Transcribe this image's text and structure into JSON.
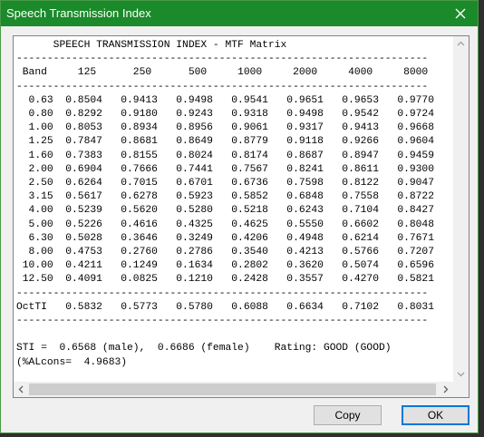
{
  "window": {
    "title": "Speech Transmission Index"
  },
  "content": {
    "lines": [
      "      SPEECH TRANSMISSION INDEX - MTF Matrix",
      "-------------------------------------------------------------------",
      " Band     125      250      500     1000     2000     4000     8000",
      "-------------------------------------------------------------------",
      "  0.63  0.8504   0.9413   0.9498   0.9541   0.9651   0.9653   0.9770",
      "  0.80  0.8292   0.9180   0.9243   0.9318   0.9498   0.9542   0.9724",
      "  1.00  0.8053   0.8934   0.8956   0.9061   0.9317   0.9413   0.9668",
      "  1.25  0.7847   0.8681   0.8649   0.8779   0.9118   0.9266   0.9604",
      "  1.60  0.7383   0.8155   0.8024   0.8174   0.8687   0.8947   0.9459",
      "  2.00  0.6904   0.7666   0.7441   0.7567   0.8241   0.8611   0.9300",
      "  2.50  0.6264   0.7015   0.6701   0.6736   0.7598   0.8122   0.9047",
      "  3.15  0.5617   0.6278   0.5923   0.5852   0.6848   0.7558   0.8722",
      "  4.00  0.5239   0.5620   0.5280   0.5218   0.6243   0.7104   0.8427",
      "  5.00  0.5226   0.4616   0.4325   0.4625   0.5550   0.6602   0.8048",
      "  6.30  0.5028   0.3646   0.3249   0.4206   0.4948   0.6214   0.7671",
      "  8.00  0.4753   0.2760   0.2786   0.3540   0.4213   0.5766   0.7207",
      " 10.00  0.4211   0.1249   0.1634   0.2802   0.3620   0.5074   0.6596",
      " 12.50  0.4091   0.0825   0.1210   0.2428   0.3557   0.4270   0.5821",
      "-------------------------------------------------------------------",
      "OctTI   0.5832   0.5773   0.5780   0.6088   0.6634   0.7102   0.8031",
      "-------------------------------------------------------------------",
      "",
      "STI =  0.6568 (male),  0.6686 (female)    Rating: GOOD (GOOD)",
      "(%ALcons=  4.9683)"
    ]
  },
  "buttons": {
    "copy": "Copy",
    "ok": "OK"
  },
  "colors": {
    "titlebar": "#1b8a2a",
    "text": "#000000"
  }
}
